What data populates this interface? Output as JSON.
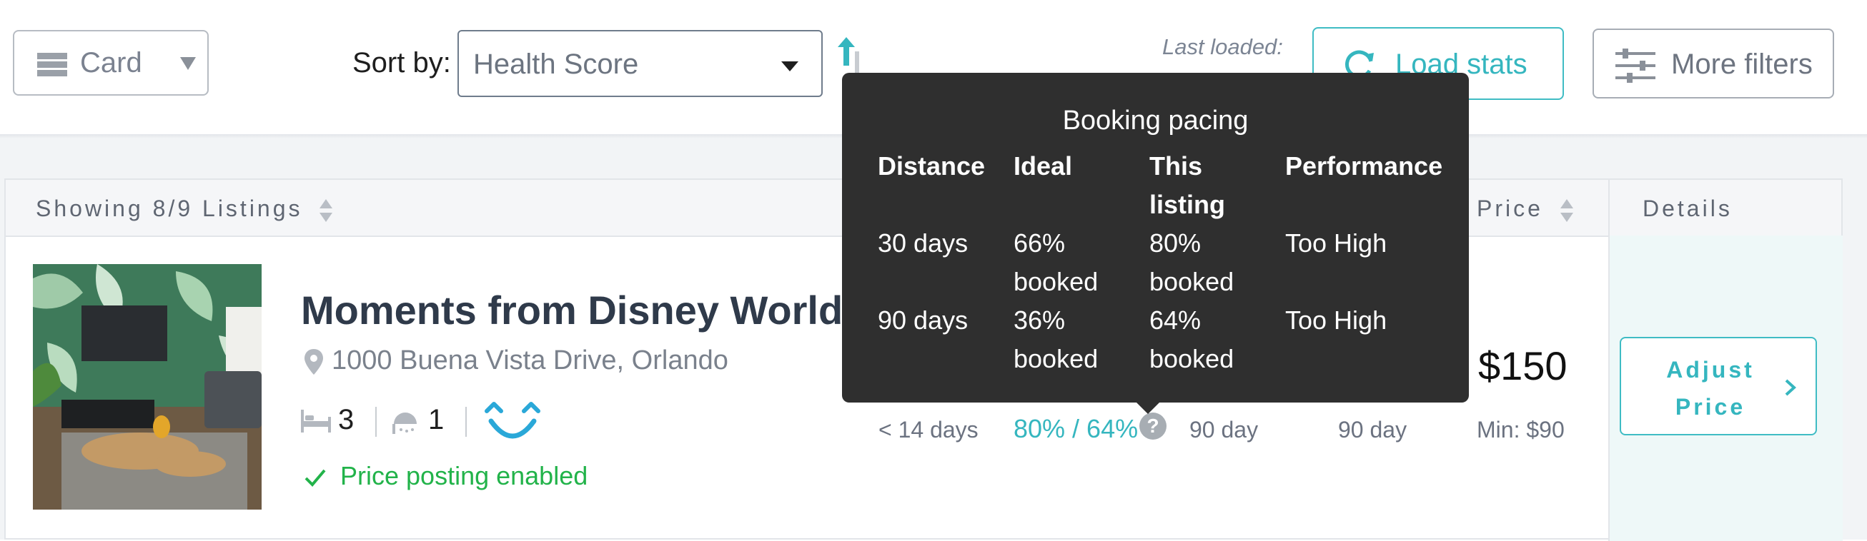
{
  "toolbar": {
    "view_label": "Card",
    "sort_label": "Sort by:",
    "sort_value": "Health Score",
    "last_loaded_label": "Last loaded:",
    "load_stats_label": "Load stats",
    "more_filters_label": "More filters"
  },
  "table": {
    "headers": {
      "listings": "Showing 8/9 Listings",
      "price": "Price",
      "details": "Details"
    }
  },
  "listing": {
    "title": "Moments from Disney World!",
    "address": "1000 Buena Vista Drive, Orlando",
    "bedrooms": "3",
    "bathrooms": "1",
    "posting_status": "Price posting enabled",
    "lead_time": "< 14 days",
    "pacing": "80% / 64%",
    "stat_a": "90 day",
    "stat_b": "90 day",
    "price": "$150",
    "min_price": "Min: $90",
    "adjust_label": "Adjust Price"
  },
  "tooltip": {
    "title": "Booking pacing",
    "headers": [
      "Distance",
      "Ideal",
      "This listing",
      "Performance"
    ],
    "rows": [
      [
        "30 days",
        "66% booked",
        "80% booked",
        "Too High"
      ],
      [
        "90 days",
        "36% booked",
        "64% booked",
        "Too High"
      ]
    ]
  },
  "icons": {
    "view": "card-view-icon",
    "sort_direction": "sort-ascending-icon",
    "load": "refresh-icon",
    "filters": "sliders-icon",
    "address": "location-pin-icon",
    "bed": "bed-icon",
    "bath": "shower-icon",
    "health": "smiley-face-icon",
    "posting": "checkmark-icon",
    "help": "question-icon",
    "adjust": "chevron-right-icon"
  },
  "colors": {
    "accent": "#35b6bf",
    "success": "#22b34a",
    "tooltip_bg": "#2f2f2f"
  }
}
